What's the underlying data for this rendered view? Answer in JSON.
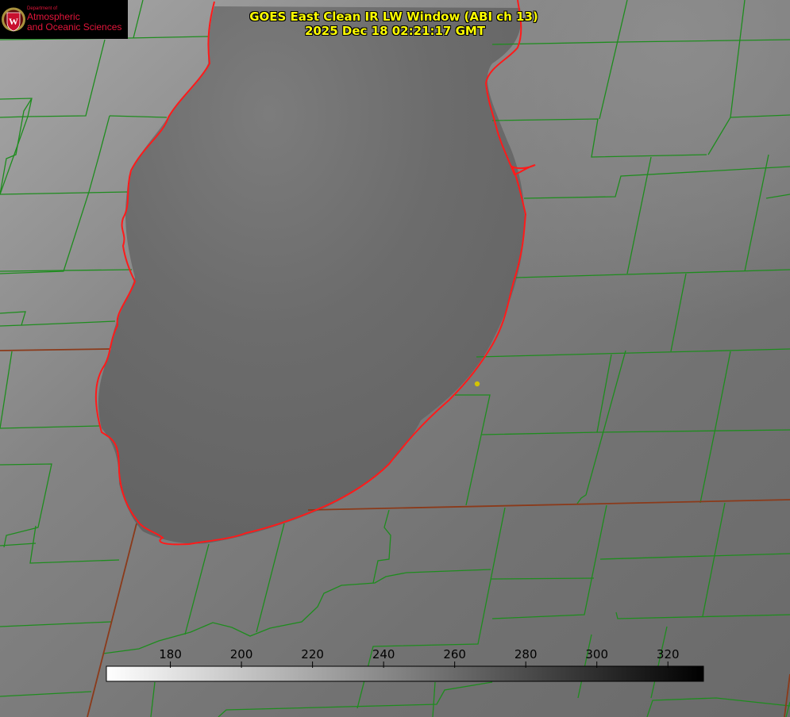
{
  "title": {
    "line1": "GOES East Clean IR LW Window (ABI ch 13)",
    "line2": "2025 Dec 18 02:21:17 GMT"
  },
  "logo": {
    "department": "Department of",
    "line1": "Atmospheric",
    "line2": "and Oceanic Sciences",
    "crest_letter": "W"
  },
  "colorbar": {
    "ticks": [
      "180",
      "200",
      "220",
      "240",
      "260",
      "280",
      "300",
      "320"
    ],
    "range": [
      162,
      330
    ],
    "gradient": "white-to-black"
  },
  "colors": {
    "county_lines": "#1e8c1e",
    "state_lines": "#8b3a1a",
    "lake_shoreline": "#ff1a1a",
    "title_text": "#ffff00",
    "point_marker": "#d4c400"
  }
}
